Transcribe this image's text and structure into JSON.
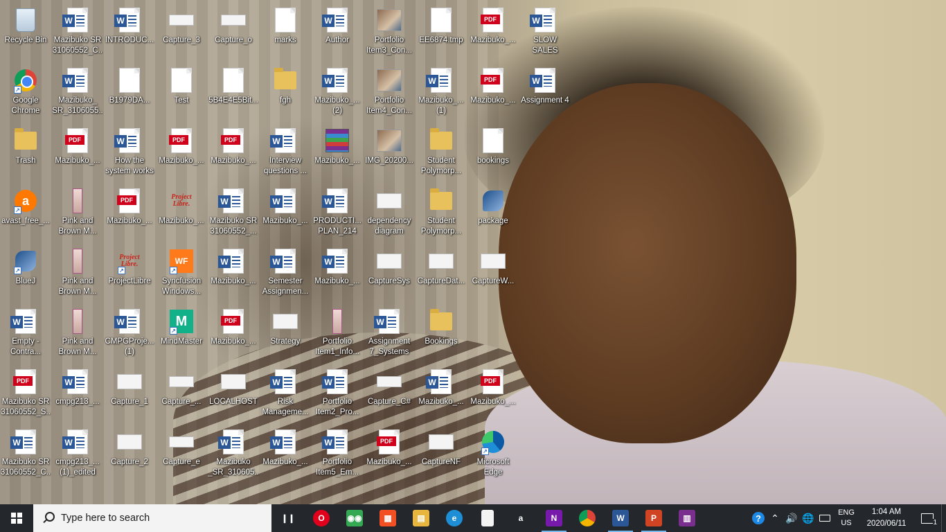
{
  "desktop": {
    "icons": [
      {
        "label": "Recycle Bin",
        "icon": "recycle-bin-icon",
        "kind": "recycle",
        "col": 0,
        "row": 0
      },
      {
        "label": "Google Chrome",
        "icon": "chrome-icon",
        "kind": "chrome",
        "col": 0,
        "row": 1,
        "shortcut": true
      },
      {
        "label": "Trash",
        "icon": "folder-icon",
        "kind": "folder",
        "col": 0,
        "row": 2
      },
      {
        "label": "avast_free_...",
        "icon": "avast-icon",
        "kind": "avast",
        "col": 0,
        "row": 3,
        "shortcut": true
      },
      {
        "label": "BlueJ",
        "icon": "bluej-icon",
        "kind": "bluej",
        "col": 0,
        "row": 4,
        "shortcut": true
      },
      {
        "label": "Empty - Contra...",
        "icon": "word-document-icon",
        "kind": "word",
        "col": 0,
        "row": 5
      },
      {
        "label": "Mazibuko SR 31060552_S...",
        "icon": "pdf-document-icon",
        "kind": "pdf",
        "col": 0,
        "row": 6
      },
      {
        "label": "Mazibuko SR 31060552_C...",
        "icon": "word-document-icon",
        "kind": "word",
        "col": 0,
        "row": 7
      },
      {
        "label": "Mazibuko SR 31060552_C...",
        "icon": "word-document-icon",
        "kind": "word",
        "col": 1,
        "row": 0
      },
      {
        "label": "Mazibuko_ SR_3106055...",
        "icon": "word-document-icon",
        "kind": "word",
        "col": 1,
        "row": 1
      },
      {
        "label": "Mazibuko_...",
        "icon": "pdf-document-icon",
        "kind": "pdf",
        "col": 1,
        "row": 2
      },
      {
        "label": "Pink and Brown M...",
        "icon": "image-strip-icon",
        "kind": "strip",
        "col": 1,
        "row": 3
      },
      {
        "label": "Pink and Brown M...",
        "icon": "image-strip-icon",
        "kind": "strip",
        "col": 1,
        "row": 4
      },
      {
        "label": "Pink and Brown M...",
        "icon": "image-strip-icon",
        "kind": "strip",
        "col": 1,
        "row": 5
      },
      {
        "label": "cmpg213_...",
        "icon": "word-document-icon",
        "kind": "word",
        "col": 1,
        "row": 6
      },
      {
        "label": "cmpg213_... (1)_edited",
        "icon": "word-document-icon",
        "kind": "word",
        "col": 1,
        "row": 7
      },
      {
        "label": "INTRODUC...",
        "icon": "word-document-icon",
        "kind": "word",
        "col": 2,
        "row": 0
      },
      {
        "label": "B1979DA...",
        "icon": "blank-file-icon",
        "kind": "doc",
        "col": 2,
        "row": 1
      },
      {
        "label": "How the system works",
        "icon": "word-document-icon",
        "kind": "word",
        "col": 2,
        "row": 2
      },
      {
        "label": "Mazibuko_...",
        "icon": "pdf-document-icon",
        "kind": "pdf",
        "col": 2,
        "row": 3
      },
      {
        "label": "ProjectLibre",
        "icon": "projectlibre-icon",
        "kind": "plibre",
        "col": 2,
        "row": 4,
        "shortcut": true
      },
      {
        "label": "CMPGProje... (1)",
        "icon": "word-document-icon",
        "kind": "word",
        "col": 2,
        "row": 5
      },
      {
        "label": "Capture_1",
        "icon": "image-thumbnail-icon",
        "kind": "thumb",
        "col": 2,
        "row": 6
      },
      {
        "label": "Capture_2",
        "icon": "image-thumbnail-icon",
        "kind": "thumb",
        "col": 2,
        "row": 7
      },
      {
        "label": "Capture_3",
        "icon": "image-thumbnail-icon",
        "kind": "thumbsmall",
        "col": 3,
        "row": 0
      },
      {
        "label": "Test",
        "icon": "visual-studio-file-icon",
        "kind": "doc",
        "col": 3,
        "row": 1
      },
      {
        "label": "Mazibuko_...",
        "icon": "pdf-document-icon",
        "kind": "pdf",
        "col": 3,
        "row": 2
      },
      {
        "label": "Mazibuko_...",
        "icon": "projectlibre-file-icon",
        "kind": "plibre",
        "col": 3,
        "row": 3
      },
      {
        "label": "Syncfusion Windows...",
        "icon": "syncfusion-icon",
        "kind": "wf",
        "col": 3,
        "row": 4,
        "shortcut": true
      },
      {
        "label": "MindMaster",
        "icon": "mindmaster-icon",
        "kind": "mm",
        "col": 3,
        "row": 5,
        "shortcut": true
      },
      {
        "label": "Capture_...",
        "icon": "image-thumbnail-icon",
        "kind": "thumbsmall",
        "col": 3,
        "row": 6
      },
      {
        "label": "Capture_e",
        "icon": "image-thumbnail-icon",
        "kind": "thumbsmall",
        "col": 3,
        "row": 7
      },
      {
        "label": "Capture_o",
        "icon": "image-thumbnail-icon",
        "kind": "thumbsmall",
        "col": 4,
        "row": 0
      },
      {
        "label": "5B4E4E5Bit...",
        "icon": "blank-file-icon",
        "kind": "doc",
        "col": 4,
        "row": 1
      },
      {
        "label": "Mazibuko_...",
        "icon": "pdf-document-icon",
        "kind": "pdf",
        "col": 4,
        "row": 2
      },
      {
        "label": "Mazibuko SR 31060552_...",
        "icon": "word-document-icon",
        "kind": "word",
        "col": 4,
        "row": 3
      },
      {
        "label": "Mazibuko_...",
        "icon": "word-document-icon",
        "kind": "word",
        "col": 4,
        "row": 4
      },
      {
        "label": "Mazibuko_...",
        "icon": "pdf-document-icon",
        "kind": "pdf",
        "col": 4,
        "row": 5
      },
      {
        "label": "LOCALHOST",
        "icon": "image-thumbnail-icon",
        "kind": "thumb",
        "col": 4,
        "row": 6
      },
      {
        "label": "Mazibuko _SR_310605...",
        "icon": "word-document-icon",
        "kind": "word",
        "col": 4,
        "row": 7
      },
      {
        "label": "marks",
        "icon": "blank-file-icon",
        "kind": "doc",
        "col": 5,
        "row": 0
      },
      {
        "label": "fgh",
        "icon": "folder-icon",
        "kind": "folder",
        "col": 5,
        "row": 1
      },
      {
        "label": "Interview questions ...",
        "icon": "word-document-icon",
        "kind": "word",
        "col": 5,
        "row": 2
      },
      {
        "label": "Mazibuko_...",
        "icon": "word-document-icon",
        "kind": "word",
        "col": 5,
        "row": 3
      },
      {
        "label": "Semester Assignmen...",
        "icon": "word-document-icon",
        "kind": "word",
        "col": 5,
        "row": 4
      },
      {
        "label": "Strategy",
        "icon": "image-thumbnail-icon",
        "kind": "thumb",
        "col": 5,
        "row": 5
      },
      {
        "label": "Risk Manageme...",
        "icon": "word-document-icon",
        "kind": "word",
        "col": 5,
        "row": 6
      },
      {
        "label": "Mazibuko_...",
        "icon": "word-document-icon",
        "kind": "word",
        "col": 5,
        "row": 7
      },
      {
        "label": "Author",
        "icon": "word-document-icon",
        "kind": "word",
        "col": 6,
        "row": 0
      },
      {
        "label": "Mazibuko_... (2)",
        "icon": "word-document-icon",
        "kind": "word",
        "col": 6,
        "row": 1
      },
      {
        "label": "Mazibuko_...",
        "icon": "winrar-archive-icon",
        "kind": "archive",
        "col": 6,
        "row": 2
      },
      {
        "label": "PRODUCTI... PLAN_214",
        "icon": "word-document-icon",
        "kind": "word",
        "col": 6,
        "row": 3
      },
      {
        "label": "Mazibuko_...",
        "icon": "word-document-icon",
        "kind": "word",
        "col": 6,
        "row": 4
      },
      {
        "label": "Portfolio Item1_Info...",
        "icon": "image-strip-icon",
        "kind": "strip",
        "col": 6,
        "row": 5
      },
      {
        "label": "Portfolio Item2_Pro...",
        "icon": "word-document-icon",
        "kind": "word",
        "col": 6,
        "row": 6
      },
      {
        "label": "Portfolio Item5_Em...",
        "icon": "word-document-icon",
        "kind": "word",
        "col": 6,
        "row": 7
      },
      {
        "label": "Portfolio Item3_Con...",
        "icon": "photo-thumbnail-icon",
        "kind": "photo",
        "col": 7,
        "row": 0
      },
      {
        "label": "Portfolio Item4_Con...",
        "icon": "photo-thumbnail-icon",
        "kind": "photo",
        "col": 7,
        "row": 1
      },
      {
        "label": "IMG_20200...",
        "icon": "photo-thumbnail-icon",
        "kind": "photo",
        "col": 7,
        "row": 2
      },
      {
        "label": "dependency diagram",
        "icon": "image-thumbnail-icon",
        "kind": "thumb",
        "col": 7,
        "row": 3
      },
      {
        "label": "CaptureSys",
        "icon": "image-thumbnail-icon",
        "kind": "thumb",
        "col": 7,
        "row": 4
      },
      {
        "label": "Assignment 7_Systems",
        "icon": "word-document-icon",
        "kind": "word",
        "col": 7,
        "row": 5
      },
      {
        "label": "Capture_C#",
        "icon": "image-thumbnail-icon",
        "kind": "thumbsmall",
        "col": 7,
        "row": 6
      },
      {
        "label": "Mazibuko_...",
        "icon": "pdf-document-icon",
        "kind": "pdf",
        "col": 7,
        "row": 7
      },
      {
        "label": "EE6874.tmp",
        "icon": "blank-file-icon",
        "kind": "doc",
        "col": 8,
        "row": 0
      },
      {
        "label": "Mazibuko_... (1)",
        "icon": "word-document-icon",
        "kind": "word",
        "col": 8,
        "row": 1
      },
      {
        "label": "Student Polymorp...",
        "icon": "folder-icon",
        "kind": "folder",
        "col": 8,
        "row": 2
      },
      {
        "label": "Student Polymorp...",
        "icon": "folder-icon",
        "kind": "folder",
        "col": 8,
        "row": 3
      },
      {
        "label": "CaptureDat...",
        "icon": "image-thumbnail-icon",
        "kind": "thumb",
        "col": 8,
        "row": 4
      },
      {
        "label": "Bookings",
        "icon": "folder-icon",
        "kind": "folder",
        "col": 8,
        "row": 5
      },
      {
        "label": "Mazibuko_...",
        "icon": "word-document-icon",
        "kind": "word",
        "col": 8,
        "row": 6
      },
      {
        "label": "CaptureNF",
        "icon": "image-thumbnail-icon",
        "kind": "thumb",
        "col": 8,
        "row": 7
      },
      {
        "label": "Mazibuko_...",
        "icon": "pdf-document-icon",
        "kind": "pdf",
        "col": 9,
        "row": 0
      },
      {
        "label": "Mazibuko_...",
        "icon": "pdf-document-icon",
        "kind": "pdf",
        "col": 9,
        "row": 1
      },
      {
        "label": "bookings",
        "icon": "blank-file-icon",
        "kind": "doc",
        "col": 9,
        "row": 2
      },
      {
        "label": "package",
        "icon": "bluej-icon",
        "kind": "bluej",
        "col": 9,
        "row": 3
      },
      {
        "label": "CaptureW...",
        "icon": "image-thumbnail-icon",
        "kind": "thumb",
        "col": 9,
        "row": 4
      },
      {
        "label": "Mazibuko_...",
        "icon": "pdf-document-icon",
        "kind": "pdf",
        "col": 9,
        "row": 6
      },
      {
        "label": "Microsoft Edge",
        "icon": "edge-icon",
        "kind": "edge",
        "col": 9,
        "row": 7,
        "shortcut": true
      },
      {
        "label": "SLOW SALES",
        "icon": "word-document-icon",
        "kind": "word",
        "col": 10,
        "row": 0
      },
      {
        "label": "Assignment 4",
        "icon": "word-document-icon",
        "kind": "word",
        "col": 10,
        "row": 1
      }
    ]
  },
  "taskbar": {
    "search_placeholder": "Type here to search",
    "apps": [
      {
        "name": "task-view-icon",
        "glyph": "❙❙",
        "color": "#24282d",
        "active": false
      },
      {
        "name": "opera-icon",
        "glyph": "O",
        "color": "#e0001b",
        "active": false
      },
      {
        "name": "tripadvisor-icon",
        "glyph": "◉◉",
        "color": "#34a853",
        "active": false
      },
      {
        "name": "microsoft-store-icon",
        "glyph": "▦",
        "color": "#f25022",
        "active": false
      },
      {
        "name": "file-explorer-icon",
        "glyph": "▤",
        "color": "#e8b53e",
        "active": false
      },
      {
        "name": "edge-icon",
        "glyph": "e",
        "color": "#1e8fd6",
        "active": false
      },
      {
        "name": "blank-document-icon",
        "glyph": "",
        "color": "#f4f4f4",
        "active": false
      },
      {
        "name": "amazon-icon",
        "glyph": "a",
        "color": "#24282d",
        "active": false
      },
      {
        "name": "onenote-icon",
        "glyph": "N",
        "color": "#7719aa",
        "active": true
      },
      {
        "name": "chrome-icon",
        "glyph": "",
        "color": "#db4437",
        "active": false
      },
      {
        "name": "word-icon",
        "glyph": "W",
        "color": "#2b5797",
        "active": true
      },
      {
        "name": "powerpoint-icon",
        "glyph": "P",
        "color": "#d04423",
        "active": true
      },
      {
        "name": "winrar-icon",
        "glyph": "▥",
        "color": "#7a2f8e",
        "active": false
      }
    ],
    "tray": {
      "language_line1": "ENG",
      "language_line2": "US",
      "time": "1:04 AM",
      "date": "2020/06/11",
      "notification_count": "1"
    }
  }
}
